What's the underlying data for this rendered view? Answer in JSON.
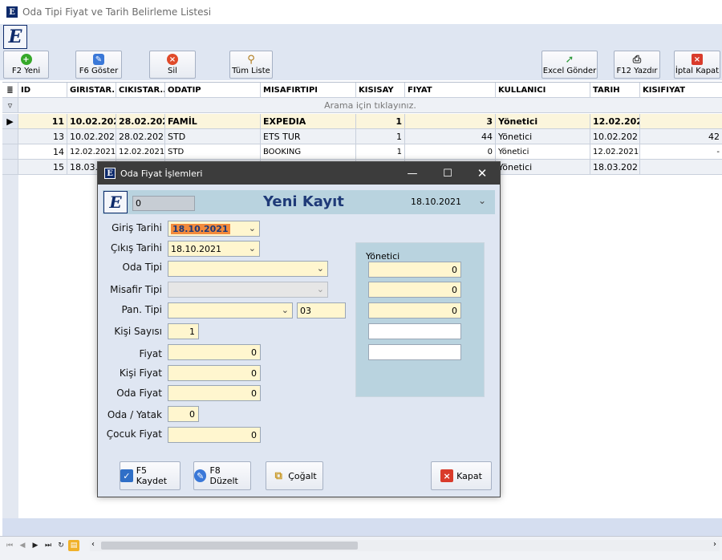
{
  "window": {
    "title": "Oda Tipi Fiyat ve Tarih Belirleme Listesi",
    "icon": "E"
  },
  "logo": "E",
  "toolbar": {
    "new_label": "F2 Yeni",
    "show_label": "F6 Göster",
    "delete_label": "Sil",
    "all_label": "Tüm Liste",
    "excel_label": "Excel Gönder",
    "print_label": "F12 Yazdır",
    "cancel_label": "İptal Kapat"
  },
  "grid": {
    "columns": [
      "ID",
      "GIRISTAR...",
      "CIKISTAR...",
      "ODATIP",
      "MISAFIRTIPI",
      "KISISAY",
      "FIYAT",
      "KULLANICI",
      "TARIH",
      "KISIFIYAT"
    ],
    "filter_hint": "Arama için tıklayınız.",
    "rows": [
      [
        "11",
        "10.02.202",
        "28.02.202",
        "FAMİL",
        "EXPEDIA",
        "1",
        "3",
        "Yönetici",
        "12.02.202",
        ""
      ],
      [
        "13",
        "10.02.202",
        "28.02.202",
        "STD",
        "ETS TUR",
        "1",
        "44",
        "Yönetici",
        "10.02.202",
        "42"
      ],
      [
        "14",
        "12.02.2021",
        "12.02.2021",
        "STD",
        "BOOKING",
        "1",
        "0",
        "Yönetici",
        "12.02.2021",
        "-"
      ],
      [
        "15",
        "18.03.",
        "",
        "",
        "",
        "",
        "",
        "Yönetici",
        "18.03.202",
        ""
      ]
    ]
  },
  "dialog": {
    "title": "Oda Fiyat İşlemleri",
    "record_id": "0",
    "heading": "Yeni Kayıt",
    "date": "18.10.2021",
    "labels": {
      "checkin": "Giriş Tarihi",
      "checkout": "Çıkış Tarihi",
      "room_type": "Oda Tipi",
      "guest_type": "Misafir Tipi",
      "board_type": "Pan. Tipi",
      "person_count": "Kişi Sayısı",
      "price": "Fiyat",
      "person_price": "Kişi Fiyat",
      "room_price": "Oda Fiyat",
      "room_bed": "Oda / Yatak",
      "child_price": "Çocuk Fiyat"
    },
    "values": {
      "checkin": "18.10.2021",
      "checkout": "18.10.2021",
      "room_type": "",
      "guest_type": "",
      "board_type": "",
      "board_code": "03",
      "person_count": "1",
      "price": "0",
      "person_price": "0",
      "room_price": "0",
      "room_bed": "0",
      "child_price": "0"
    },
    "side": {
      "user": "Yönetici",
      "values": [
        "0",
        "0",
        "0",
        "",
        ""
      ]
    },
    "buttons": {
      "save": "F5 Kaydet",
      "edit": "F8 Düzelt",
      "copy": "Çoğalt",
      "close": "Kapat"
    }
  }
}
